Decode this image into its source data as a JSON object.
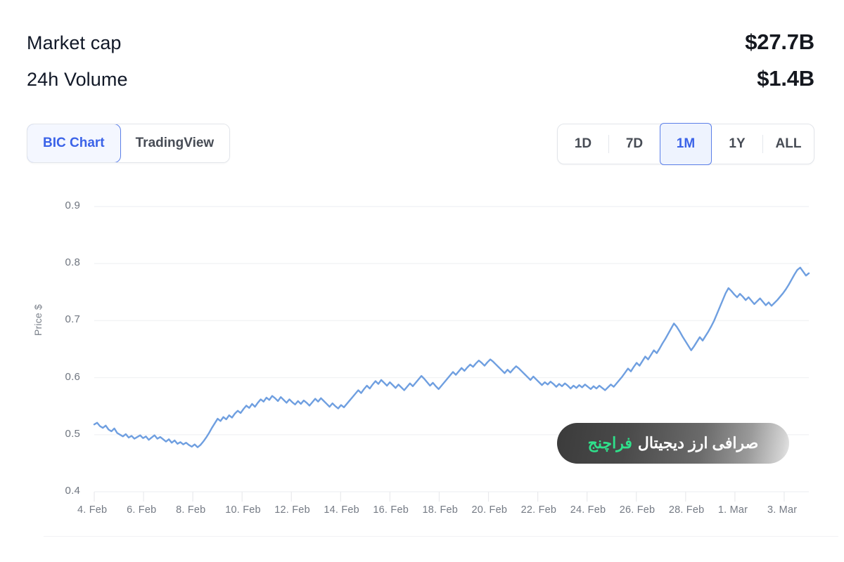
{
  "stats": [
    {
      "label": "Market cap",
      "value": "$27.7B"
    },
    {
      "label": "24h Volume",
      "value": "$1.4B"
    }
  ],
  "chart_source_tabs": [
    {
      "label": "BIC Chart",
      "active": true
    },
    {
      "label": "TradingView",
      "active": false
    }
  ],
  "ranges": [
    {
      "label": "1D",
      "active": false
    },
    {
      "label": "7D",
      "active": false
    },
    {
      "label": "1M",
      "active": true
    },
    {
      "label": "1Y",
      "active": false
    },
    {
      "label": "ALL",
      "active": false
    }
  ],
  "watermark": {
    "text_white": "صرافی ارز دیجیتال",
    "text_green": "فراچنج"
  },
  "colors": {
    "accent_blue": "#3b63e8",
    "active_fill": "#eef3fe",
    "line": "#6f9fe0",
    "grid": "#f2f3f5",
    "tick_text": "#747a84",
    "watermark_green": "#2fe08b"
  },
  "chart_data": {
    "type": "line",
    "title": "",
    "xlabel": "",
    "ylabel": "Price $",
    "ylim": [
      0.4,
      0.9
    ],
    "yticks": [
      0.9,
      0.8,
      0.7,
      0.6,
      0.5,
      0.4
    ],
    "grid": true,
    "legend": "none",
    "xticks": [
      "4. Feb",
      "6. Feb",
      "8. Feb",
      "10. Feb",
      "12. Feb",
      "14. Feb",
      "16. Feb",
      "18. Feb",
      "20. Feb",
      "22. Feb",
      "24. Feb",
      "26. Feb",
      "28. Feb",
      "1. Mar",
      "3. Mar"
    ],
    "x_start": "4. Feb",
    "x_end": "4. Mar",
    "series": [
      {
        "name": "Price",
        "color": "#6f9fe0",
        "values": [
          0.518,
          0.521,
          0.515,
          0.512,
          0.516,
          0.509,
          0.506,
          0.511,
          0.503,
          0.5,
          0.497,
          0.501,
          0.495,
          0.498,
          0.493,
          0.496,
          0.499,
          0.494,
          0.497,
          0.491,
          0.495,
          0.499,
          0.493,
          0.496,
          0.492,
          0.488,
          0.492,
          0.486,
          0.49,
          0.484,
          0.487,
          0.483,
          0.486,
          0.482,
          0.479,
          0.483,
          0.478,
          0.482,
          0.488,
          0.495,
          0.503,
          0.512,
          0.52,
          0.528,
          0.524,
          0.531,
          0.527,
          0.534,
          0.53,
          0.537,
          0.542,
          0.538,
          0.545,
          0.551,
          0.547,
          0.554,
          0.549,
          0.556,
          0.562,
          0.558,
          0.565,
          0.561,
          0.568,
          0.564,
          0.559,
          0.566,
          0.561,
          0.556,
          0.562,
          0.557,
          0.553,
          0.559,
          0.554,
          0.56,
          0.556,
          0.551,
          0.557,
          0.563,
          0.558,
          0.564,
          0.559,
          0.554,
          0.549,
          0.555,
          0.55,
          0.546,
          0.552,
          0.548,
          0.554,
          0.56,
          0.566,
          0.572,
          0.578,
          0.573,
          0.58,
          0.586,
          0.581,
          0.588,
          0.594,
          0.589,
          0.596,
          0.591,
          0.586,
          0.592,
          0.587,
          0.582,
          0.588,
          0.583,
          0.578,
          0.584,
          0.59,
          0.585,
          0.591,
          0.597,
          0.603,
          0.598,
          0.592,
          0.586,
          0.591,
          0.585,
          0.58,
          0.586,
          0.592,
          0.598,
          0.604,
          0.61,
          0.605,
          0.611,
          0.617,
          0.612,
          0.618,
          0.623,
          0.619,
          0.625,
          0.63,
          0.626,
          0.621,
          0.627,
          0.632,
          0.628,
          0.623,
          0.618,
          0.613,
          0.608,
          0.614,
          0.609,
          0.615,
          0.62,
          0.616,
          0.611,
          0.606,
          0.601,
          0.596,
          0.602,
          0.597,
          0.592,
          0.587,
          0.592,
          0.588,
          0.593,
          0.589,
          0.584,
          0.589,
          0.585,
          0.59,
          0.586,
          0.581,
          0.586,
          0.582,
          0.587,
          0.583,
          0.588,
          0.584,
          0.58,
          0.585,
          0.581,
          0.586,
          0.582,
          0.578,
          0.583,
          0.588,
          0.584,
          0.59,
          0.596,
          0.602,
          0.609,
          0.616,
          0.611,
          0.619,
          0.626,
          0.621,
          0.629,
          0.637,
          0.632,
          0.64,
          0.648,
          0.643,
          0.651,
          0.66,
          0.668,
          0.677,
          0.686,
          0.695,
          0.689,
          0.681,
          0.672,
          0.664,
          0.656,
          0.648,
          0.655,
          0.663,
          0.671,
          0.665,
          0.673,
          0.681,
          0.69,
          0.7,
          0.712,
          0.724,
          0.736,
          0.748,
          0.757,
          0.752,
          0.746,
          0.741,
          0.747,
          0.742,
          0.736,
          0.741,
          0.735,
          0.729,
          0.734,
          0.739,
          0.733,
          0.727,
          0.732,
          0.726,
          0.731,
          0.736,
          0.742,
          0.748,
          0.755,
          0.763,
          0.772,
          0.781,
          0.789,
          0.793,
          0.786,
          0.779,
          0.783
        ]
      }
    ]
  }
}
